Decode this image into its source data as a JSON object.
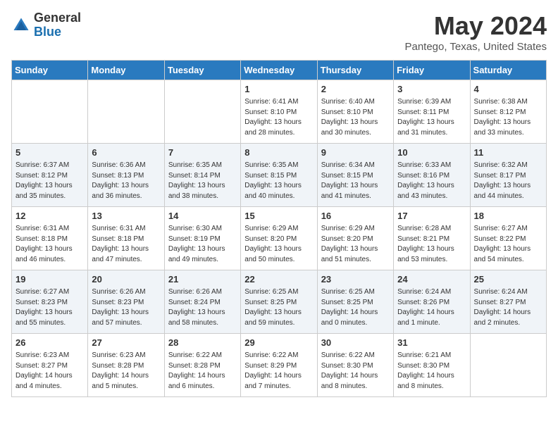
{
  "logo": {
    "general": "General",
    "blue": "Blue"
  },
  "title": "May 2024",
  "subtitle": "Pantego, Texas, United States",
  "days_of_week": [
    "Sunday",
    "Monday",
    "Tuesday",
    "Wednesday",
    "Thursday",
    "Friday",
    "Saturday"
  ],
  "weeks": [
    [
      {
        "day": "",
        "info": ""
      },
      {
        "day": "",
        "info": ""
      },
      {
        "day": "",
        "info": ""
      },
      {
        "day": "1",
        "info": "Sunrise: 6:41 AM\nSunset: 8:10 PM\nDaylight: 13 hours\nand 28 minutes."
      },
      {
        "day": "2",
        "info": "Sunrise: 6:40 AM\nSunset: 8:10 PM\nDaylight: 13 hours\nand 30 minutes."
      },
      {
        "day": "3",
        "info": "Sunrise: 6:39 AM\nSunset: 8:11 PM\nDaylight: 13 hours\nand 31 minutes."
      },
      {
        "day": "4",
        "info": "Sunrise: 6:38 AM\nSunset: 8:12 PM\nDaylight: 13 hours\nand 33 minutes."
      }
    ],
    [
      {
        "day": "5",
        "info": "Sunrise: 6:37 AM\nSunset: 8:12 PM\nDaylight: 13 hours\nand 35 minutes."
      },
      {
        "day": "6",
        "info": "Sunrise: 6:36 AM\nSunset: 8:13 PM\nDaylight: 13 hours\nand 36 minutes."
      },
      {
        "day": "7",
        "info": "Sunrise: 6:35 AM\nSunset: 8:14 PM\nDaylight: 13 hours\nand 38 minutes."
      },
      {
        "day": "8",
        "info": "Sunrise: 6:35 AM\nSunset: 8:15 PM\nDaylight: 13 hours\nand 40 minutes."
      },
      {
        "day": "9",
        "info": "Sunrise: 6:34 AM\nSunset: 8:15 PM\nDaylight: 13 hours\nand 41 minutes."
      },
      {
        "day": "10",
        "info": "Sunrise: 6:33 AM\nSunset: 8:16 PM\nDaylight: 13 hours\nand 43 minutes."
      },
      {
        "day": "11",
        "info": "Sunrise: 6:32 AM\nSunset: 8:17 PM\nDaylight: 13 hours\nand 44 minutes."
      }
    ],
    [
      {
        "day": "12",
        "info": "Sunrise: 6:31 AM\nSunset: 8:18 PM\nDaylight: 13 hours\nand 46 minutes."
      },
      {
        "day": "13",
        "info": "Sunrise: 6:31 AM\nSunset: 8:18 PM\nDaylight: 13 hours\nand 47 minutes."
      },
      {
        "day": "14",
        "info": "Sunrise: 6:30 AM\nSunset: 8:19 PM\nDaylight: 13 hours\nand 49 minutes."
      },
      {
        "day": "15",
        "info": "Sunrise: 6:29 AM\nSunset: 8:20 PM\nDaylight: 13 hours\nand 50 minutes."
      },
      {
        "day": "16",
        "info": "Sunrise: 6:29 AM\nSunset: 8:20 PM\nDaylight: 13 hours\nand 51 minutes."
      },
      {
        "day": "17",
        "info": "Sunrise: 6:28 AM\nSunset: 8:21 PM\nDaylight: 13 hours\nand 53 minutes."
      },
      {
        "day": "18",
        "info": "Sunrise: 6:27 AM\nSunset: 8:22 PM\nDaylight: 13 hours\nand 54 minutes."
      }
    ],
    [
      {
        "day": "19",
        "info": "Sunrise: 6:27 AM\nSunset: 8:23 PM\nDaylight: 13 hours\nand 55 minutes."
      },
      {
        "day": "20",
        "info": "Sunrise: 6:26 AM\nSunset: 8:23 PM\nDaylight: 13 hours\nand 57 minutes."
      },
      {
        "day": "21",
        "info": "Sunrise: 6:26 AM\nSunset: 8:24 PM\nDaylight: 13 hours\nand 58 minutes."
      },
      {
        "day": "22",
        "info": "Sunrise: 6:25 AM\nSunset: 8:25 PM\nDaylight: 13 hours\nand 59 minutes."
      },
      {
        "day": "23",
        "info": "Sunrise: 6:25 AM\nSunset: 8:25 PM\nDaylight: 14 hours\nand 0 minutes."
      },
      {
        "day": "24",
        "info": "Sunrise: 6:24 AM\nSunset: 8:26 PM\nDaylight: 14 hours\nand 1 minute."
      },
      {
        "day": "25",
        "info": "Sunrise: 6:24 AM\nSunset: 8:27 PM\nDaylight: 14 hours\nand 2 minutes."
      }
    ],
    [
      {
        "day": "26",
        "info": "Sunrise: 6:23 AM\nSunset: 8:27 PM\nDaylight: 14 hours\nand 4 minutes."
      },
      {
        "day": "27",
        "info": "Sunrise: 6:23 AM\nSunset: 8:28 PM\nDaylight: 14 hours\nand 5 minutes."
      },
      {
        "day": "28",
        "info": "Sunrise: 6:22 AM\nSunset: 8:28 PM\nDaylight: 14 hours\nand 6 minutes."
      },
      {
        "day": "29",
        "info": "Sunrise: 6:22 AM\nSunset: 8:29 PM\nDaylight: 14 hours\nand 7 minutes."
      },
      {
        "day": "30",
        "info": "Sunrise: 6:22 AM\nSunset: 8:30 PM\nDaylight: 14 hours\nand 8 minutes."
      },
      {
        "day": "31",
        "info": "Sunrise: 6:21 AM\nSunset: 8:30 PM\nDaylight: 14 hours\nand 8 minutes."
      },
      {
        "day": "",
        "info": ""
      }
    ]
  ]
}
